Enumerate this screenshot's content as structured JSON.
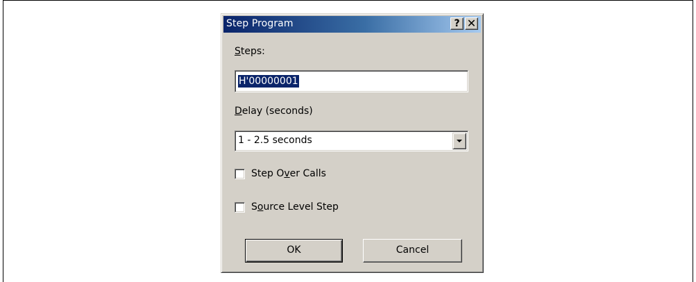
{
  "dialog": {
    "title": "Step Program",
    "help_button": "?",
    "close_button": "✕"
  },
  "steps": {
    "label_mnemonic": "S",
    "label_rest": "teps:",
    "value": "H'00000001"
  },
  "delay": {
    "label_mnemonic": "D",
    "label_rest": "elay (seconds)",
    "selected": "1 - 2.5 seconds"
  },
  "step_over_calls": {
    "label_pre": "Step O",
    "label_mnemonic": "v",
    "label_post": "er Calls",
    "checked": false
  },
  "source_level_step": {
    "label_pre": "S",
    "label_mnemonic": "o",
    "label_post": "urce Level Step",
    "checked": false
  },
  "buttons": {
    "ok": "OK",
    "cancel": "Cancel"
  }
}
